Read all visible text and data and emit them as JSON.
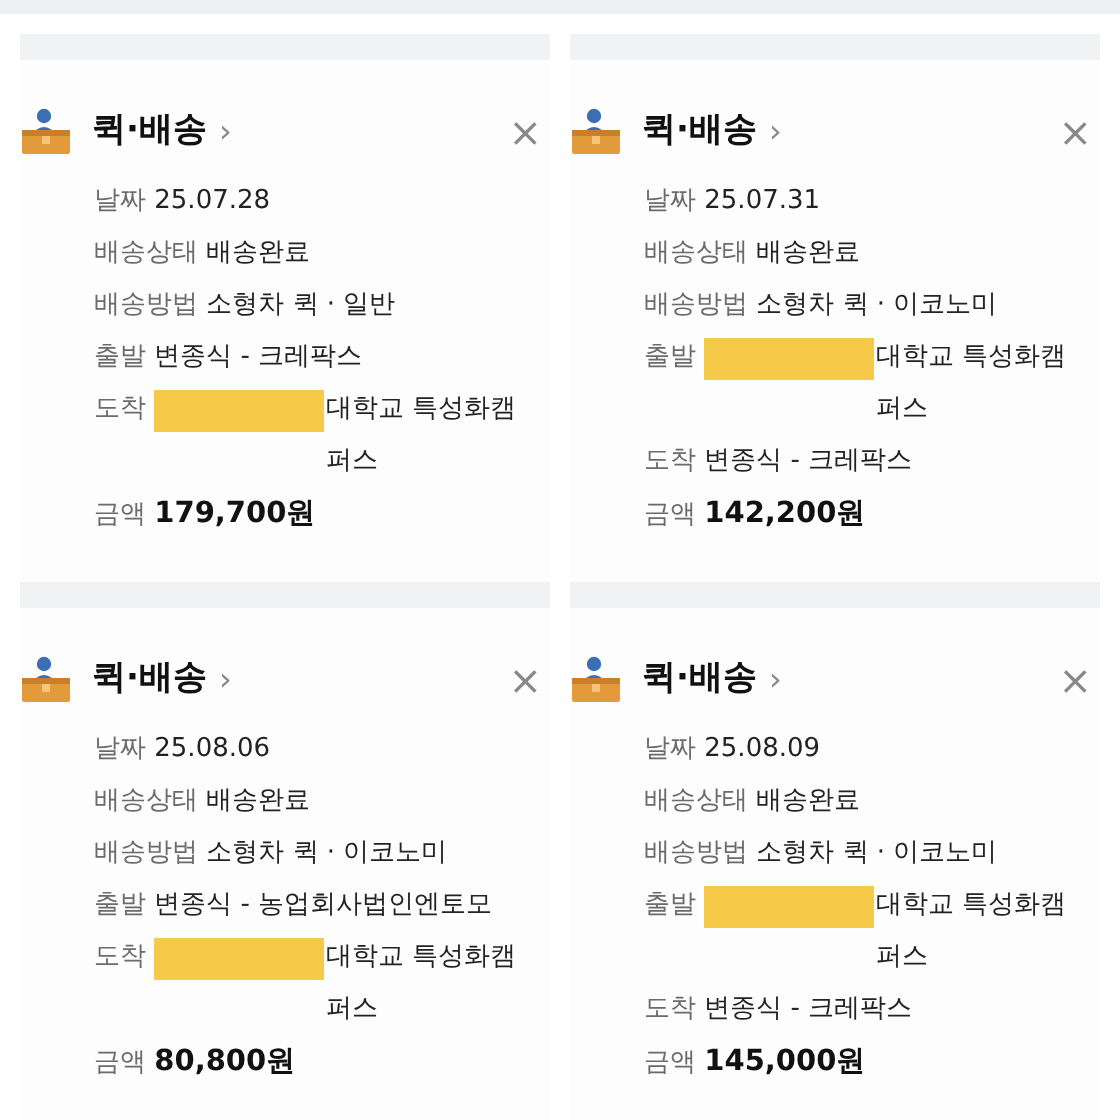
{
  "cards": [
    {
      "title": "퀵·배송",
      "chevron": "›",
      "close": "×",
      "rows": [
        {
          "label": "날짜",
          "value": "25.07.28"
        },
        {
          "label": "배송상태",
          "value": "배송완료"
        },
        {
          "label": "배송방법",
          "value": "소형차 퀵 · 일반"
        },
        {
          "label": "출발",
          "value": "변종식 - 크레팍스"
        },
        {
          "label": "도착",
          "value": "대학교 특성화캠퍼스",
          "redacted": true
        },
        {
          "label": "금액",
          "value": "179,700원",
          "kind": "amount"
        }
      ]
    },
    {
      "title": "퀵·배송",
      "chevron": "›",
      "close": "×",
      "rows": [
        {
          "label": "날짜",
          "value": "25.07.31"
        },
        {
          "label": "배송상태",
          "value": "배송완료"
        },
        {
          "label": "배송방법",
          "value": "소형차 퀵 · 이코노미"
        },
        {
          "label": "출발",
          "value": "대학교 특성화캠퍼스",
          "redacted": true
        },
        {
          "label": "도착",
          "value": "변종식 - 크레팍스"
        },
        {
          "label": "금액",
          "value": "142,200원",
          "kind": "amount"
        }
      ]
    },
    {
      "title": "퀵·배송",
      "chevron": "›",
      "close": "×",
      "rows": [
        {
          "label": "날짜",
          "value": "25.08.06"
        },
        {
          "label": "배송상태",
          "value": "배송완료"
        },
        {
          "label": "배송방법",
          "value": "소형차 퀵 · 이코노미"
        },
        {
          "label": "출발",
          "value": "변종식 - 농업회사법인엔토모"
        },
        {
          "label": "도착",
          "value": "대학교 특성화캠퍼스",
          "redacted": true
        },
        {
          "label": "금액",
          "value": "80,800원",
          "kind": "amount"
        }
      ]
    },
    {
      "title": "퀵·배송",
      "chevron": "›",
      "close": "×",
      "rows": [
        {
          "label": "날짜",
          "value": "25.08.09"
        },
        {
          "label": "배송상태",
          "value": "배송완료"
        },
        {
          "label": "배송방법",
          "value": "소형차 퀵 · 이코노미"
        },
        {
          "label": "출발",
          "value": "대학교 특성화캠퍼스",
          "redacted": true
        },
        {
          "label": "도착",
          "value": "변종식 - 크레팍스"
        },
        {
          "label": "금액",
          "value": "145,000원",
          "kind": "amount"
        }
      ]
    }
  ]
}
